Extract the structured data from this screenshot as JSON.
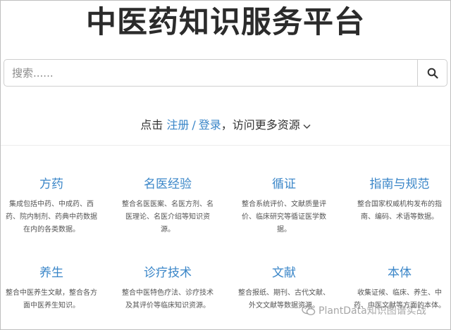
{
  "header": {
    "title": "中医药知识服务平台"
  },
  "search": {
    "placeholder": "搜索......"
  },
  "login": {
    "prefix": "点击",
    "register": "注册",
    "separator": "/",
    "signin": "登录",
    "suffix": "，访问更多资源"
  },
  "categories": [
    {
      "title": "方药",
      "desc": "集成包括中药、中成药、西药、院内制剂、药典中药数据在内的各类数据。"
    },
    {
      "title": "名医经验",
      "desc": "整合名医医案、名医方剂、名医理论、名医介绍等知识资源。"
    },
    {
      "title": "循证",
      "desc": "整合系统评价、文献质量评价、临床研究等循证医学数据。"
    },
    {
      "title": "指南与规范",
      "desc": "整合国家权威机构发布的指南、编码、术语等数据。"
    },
    {
      "title": "养生",
      "desc": "整合中医养生文献，整合各方面中医养生知识。"
    },
    {
      "title": "诊疗技术",
      "desc": "整合中医特色疗法、诊疗技术及其评价等临床知识资源。"
    },
    {
      "title": "文献",
      "desc": "整合报纸、期刊、古代文献、外文文献等数据资源。"
    },
    {
      "title": "本体",
      "desc": "收集证候、临床、养生、中药、中医文献等方面的本体。"
    }
  ],
  "watermark": {
    "text": "PlantData知识图谱实战"
  },
  "colors": {
    "link": "#3a86c8",
    "title": "#2b2b2b"
  }
}
